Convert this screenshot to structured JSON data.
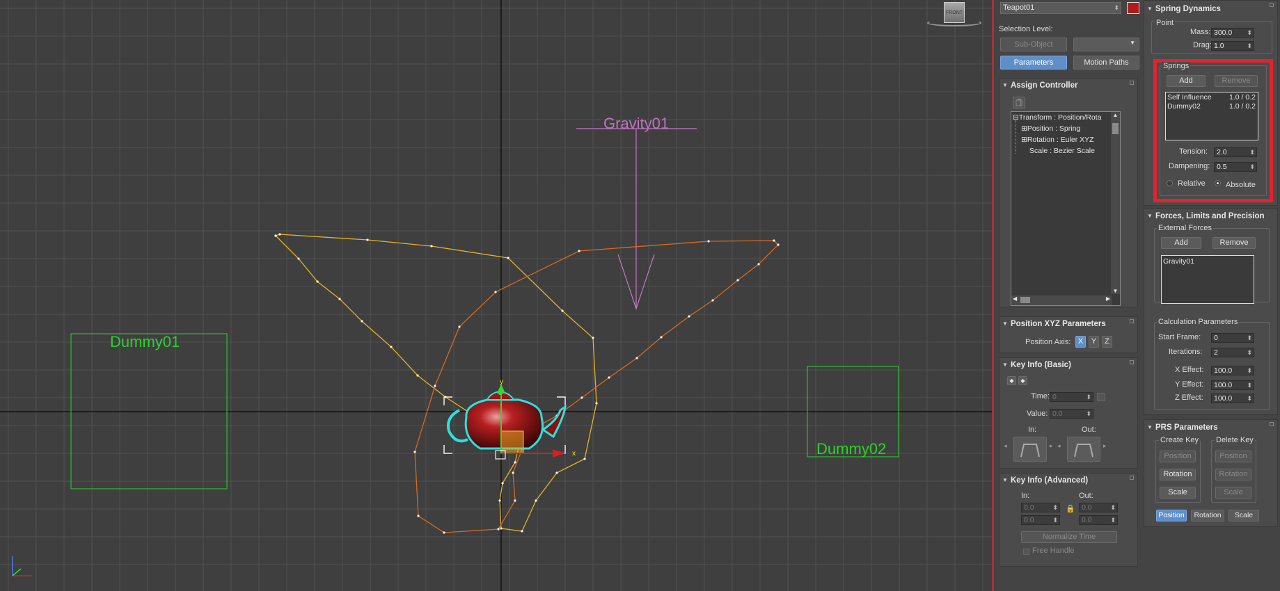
{
  "viewport": {
    "labels": {
      "gravity": "Gravity01",
      "dummy1": "Dummy01",
      "dummy2": "Dummy02"
    },
    "viewcube_label": "FRONT",
    "axis_x": "x",
    "axis_y": "y",
    "colors": {
      "grid": "#505050",
      "axes": "#111111",
      "dummy": "#2ad42a",
      "gravity": "#c877c8",
      "path_yellow": "#e7b320",
      "path_orange": "#d86a1e"
    }
  },
  "motion": {
    "object_name": "Teapot01",
    "selection_level_label": "Selection Level:",
    "sub_object_button": "Sub-Object",
    "tabs": [
      "Parameters",
      "Motion Paths"
    ],
    "assign_controller": {
      "title": "Assign Controller",
      "tree": [
        "Transform : Position/Rota",
        "Position : Spring",
        "Rotation : Euler XYZ",
        "Scale : Bezier Scale"
      ]
    },
    "position_xyz": {
      "title": "Position XYZ Parameters",
      "axis_label": "Position Axis:",
      "axes": [
        "X",
        "Y",
        "Z"
      ]
    },
    "key_info_basic": {
      "title": "Key Info (Basic)",
      "time_label": "Time:",
      "time_value": "0",
      "value_label": "Value:",
      "value_value": "0.0",
      "in_label": "In:",
      "out_label": "Out:"
    },
    "key_info_adv": {
      "title": "Key Info (Advanced)",
      "in_label": "In:",
      "out_label": "Out:",
      "fields": [
        "0.0",
        "0.0",
        "0.0",
        "0.0"
      ],
      "normalize": "Normalize Time",
      "free_handle": "Free Handle"
    }
  },
  "spring": {
    "title": "Spring Dynamics",
    "point": {
      "group": "Point",
      "mass_label": "Mass:",
      "mass": "300.0",
      "drag_label": "Drag:",
      "drag": "1.0"
    },
    "springs": {
      "group": "Springs",
      "add": "Add",
      "remove": "Remove",
      "items": [
        {
          "name": "Self Influence",
          "value": "1.0 / 0.2"
        },
        {
          "name": "Dummy02",
          "value": "1.0 / 0.2"
        }
      ],
      "tension_label": "Tension:",
      "tension": "2.0",
      "dampening_label": "Dampening:",
      "dampening": "0.5",
      "relative": "Relative",
      "absolute": "Absolute"
    },
    "forces": {
      "title": "Forces, Limits and Precision",
      "group": "External Forces",
      "add": "Add",
      "remove": "Remove",
      "items": [
        "Gravity01"
      ]
    },
    "calc": {
      "group": "Calculation Parameters",
      "start_label": "Start Frame:",
      "start": "0",
      "iter_label": "Iterations:",
      "iter": "2",
      "x_label": "X Effect:",
      "x": "100.0",
      "y_label": "Y Effect:",
      "y": "100.0",
      "z_label": "Z Effect:",
      "z": "100.0"
    },
    "prs": {
      "title": "PRS Parameters",
      "create": "Create Key",
      "delete": "Delete Key",
      "create_btns": [
        "Position",
        "Rotation",
        "Scale"
      ],
      "delete_btns": [
        "Position",
        "Rotation",
        "Scale"
      ],
      "bottom_btns": [
        "Position",
        "Rotation",
        "Scale"
      ]
    },
    "highlight_color": "#e3232e"
  }
}
